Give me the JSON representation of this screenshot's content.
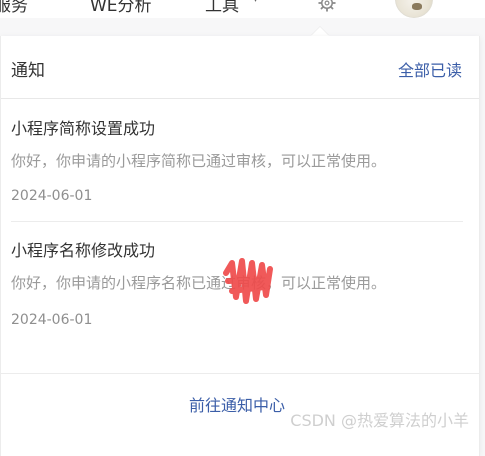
{
  "topbar": {
    "nav_left": "服务",
    "nav_middle": "WE分析",
    "nav_tools": "工具",
    "tools_caret": "▾",
    "gear_icon": "gear-icon",
    "avatar": "avatar"
  },
  "panel": {
    "title": "通知",
    "mark_all_read": "全部已读",
    "footer_link": "前往通知中心",
    "link_color": "#3b5ea8"
  },
  "notices": [
    {
      "title": "小程序简称设置成功",
      "body": "你好，你申请的小程序简称已通过审核，可以正常使用。",
      "date": "2024-06-01"
    },
    {
      "title": "小程序名称修改成功",
      "body": "你好，你申请的小程序名称已通过审核，可以正常使用。",
      "date": "2024-06-01"
    }
  ],
  "watermark": "CSDN @热爱算法的小羊"
}
